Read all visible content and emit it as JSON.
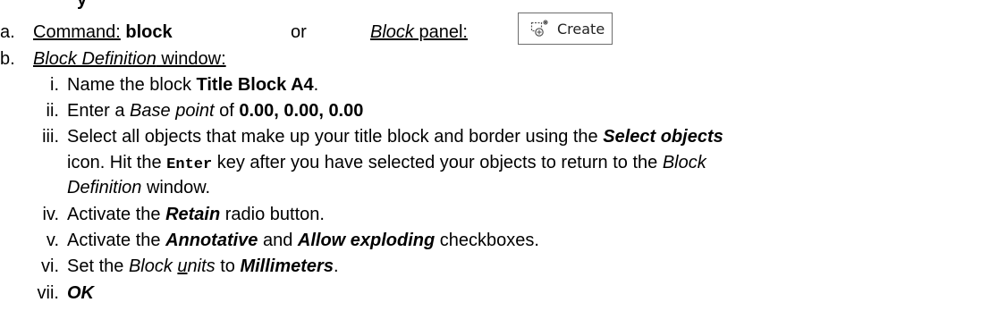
{
  "header_fragment": "y",
  "step_a": {
    "num": "a.",
    "command_label": "Command:",
    "command_value": "block",
    "or": "or",
    "panel_label": "Block",
    "panel_suffix": " panel:",
    "create_button": {
      "label": "Create",
      "icon": "create-block-icon"
    }
  },
  "step_b": {
    "num": "b.",
    "title_italic": "Block Definition",
    "title_rest": " window:"
  },
  "substeps": {
    "i": {
      "num": "i.",
      "t1": "Name the block ",
      "b1": "Title Block A4",
      "t2": "."
    },
    "ii": {
      "num": "ii.",
      "t1": "Enter a ",
      "i1": "Base point",
      "t2": " of ",
      "b1": "0.00, 0.00, 0.00"
    },
    "iii": {
      "num": "iii.",
      "t1": "Select all objects that make up your title block and border using the ",
      "bi1": "Select objects",
      "line2_t1": "icon.  Hit the ",
      "mono1": "Enter",
      "line2_t2": " key after you have selected your objects to return to the ",
      "line2_i1": "Block",
      "line3_i1": "Definition",
      "line3_t1": " window."
    },
    "iv": {
      "num": "iv.",
      "t1": "Activate the ",
      "bi1": "Retain",
      "t2": " radio button."
    },
    "v": {
      "num": "v.",
      "t1": "Activate the ",
      "bi1": "Annotative",
      "t2": " and ",
      "bi2": "Allow exploding",
      "t3": " checkboxes."
    },
    "vi": {
      "num": "vi.",
      "t1": "Set the ",
      "i1": "Block",
      "i2_u": "u",
      "i2_rest": "nits",
      "t2": " to ",
      "bi1": "Millimeters",
      "t3": "."
    },
    "vii": {
      "num": "vii.",
      "bi1": "OK"
    }
  }
}
